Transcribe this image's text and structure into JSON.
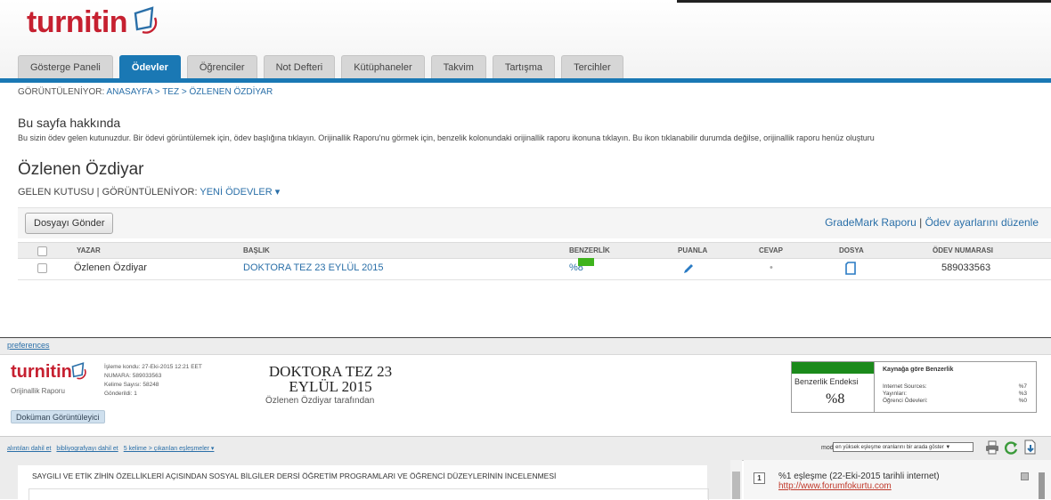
{
  "brand": {
    "logo_text": "turnitin",
    "accent": "#c62030",
    "tab_active_color": "#1a78b4"
  },
  "tabs": [
    {
      "label": "Gösterge Paneli"
    },
    {
      "label": "Ödevler",
      "active": true
    },
    {
      "label": "Öğrenciler"
    },
    {
      "label": "Not Defteri"
    },
    {
      "label": "Kütüphaneler"
    },
    {
      "label": "Takvim"
    },
    {
      "label": "Tartışma"
    },
    {
      "label": "Tercihler"
    }
  ],
  "breadcrumb": {
    "prefix": "GÖRÜNTÜLENİYOR: ",
    "path": "ANASAYFA > TEZ > ÖZLENEN ÖZDİYAR"
  },
  "about": {
    "heading": "Bu sayfa hakkında",
    "text": "Bu sizin ödev gelen kutunuzdur. Bir ödevi görüntülemek için, ödev başlığına tıklayın. Orijinallik Raporu'nu görmek için, benzelik kolonundaki orijinallik raporu ikonuna tıklayın. Bu ikon tıklanabilir durumda değilse, orijinallik raporu henüz oluşturu"
  },
  "page": {
    "title": "Özlenen Özdiyar",
    "inbox_label": "GELEN KUTUSU",
    "separator": " | ",
    "viewing_label": "GÖRÜNTÜLENİYOR: ",
    "viewing_value": "YENİ ÖDEVLER ▾"
  },
  "actions": {
    "submit_label": "Dosyayı Gönder",
    "grademark_label": "GradeMark Raporu",
    "separator": " | ",
    "settings_label": "Ödev ayarlarını düzenle"
  },
  "table": {
    "headers": {
      "author": "YAZAR",
      "title": "BAŞLIK",
      "similarity": "BENZERLİK",
      "grade": "PUANLA",
      "response": "CEVAP",
      "file": "DOSYA",
      "paper_id": "ÖDEV NUMARASI"
    },
    "rows": [
      {
        "author": "Özlenen Özdiyar",
        "title": "DOKTORA TEZ 23 EYLÜL 2015",
        "similarity": "%8",
        "response": "•",
        "paper_id": "589033563",
        "sim_color": "#3fb31d"
      }
    ]
  },
  "viewer": {
    "preferences_label": "preferences",
    "logo_text": "turnitin",
    "subtitle": "Orijinallik Raporu",
    "meta": {
      "processed": "İşleme kondu: 27-Eki-2015 12:21 EET",
      "id": "NUMARA: 589033563",
      "word_count": "Kelime Sayısı: 58248",
      "submitted": "Gönderildi: 1"
    },
    "doc_title_line1": "DOKTORA TEZ 23",
    "doc_title_line2": "EYLÜL 2015",
    "doc_author": "Özlenen Özdiyar tarafından",
    "doc_viewer_button": "Doküman Görüntüleyici",
    "similarity_index_label": "Benzerlik Endeksi",
    "similarity_index_value": "%8",
    "similarity_color": "#1b8a1b",
    "source_heading": "Kaynağa göre Benzerlik",
    "sources": [
      {
        "label": "Internet Sources:",
        "value": "%7"
      },
      {
        "label": "Yayınları:",
        "value": "%3"
      },
      {
        "label": "Öğrenci Ödevleri:",
        "value": "%0"
      }
    ],
    "toolbar": {
      "include_quotes": "alıntıları dahil et",
      "include_bib": "bibliyografyayı dahil et",
      "exclude_small": "5 kelime > çıkarılan eşleşmeler ▾",
      "mode_label": "mod:",
      "mode_value": "en yüksek eşleşme oranlarını bir arada göster  ▼"
    },
    "document_heading": "SAYGILI VE ETİK ZİHİN ÖZELLİKLERİ AÇISINDAN SOSYAL BİLGİLER DERSİ ÖĞRETİM PROGRAMLARI VE ÖĞRENCİ DÜZEYLERİNİN İNCELENMESİ",
    "match": {
      "number": "1",
      "text": "%1 eşleşme (22-Eki-2015 tarihli internet)",
      "url": "http://www.forumfokurtu.com"
    }
  }
}
